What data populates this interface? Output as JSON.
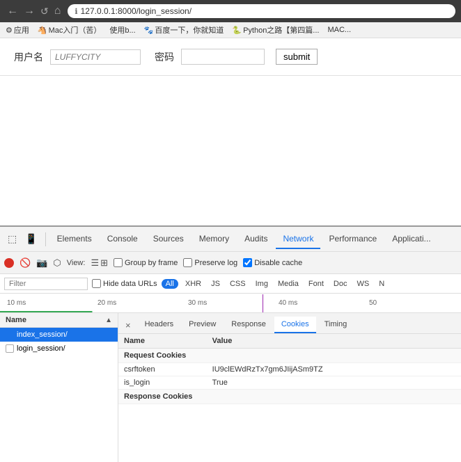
{
  "browser": {
    "back_label": "←",
    "forward_label": "→",
    "reload_label": "↺",
    "home_label": "⌂",
    "address": "127.0.0.1:8000/login_session/",
    "address_icon": "ℹ"
  },
  "bookmarks": {
    "items": [
      {
        "label": "应用",
        "icon": "⚙"
      },
      {
        "label": "Mac入门（苦）",
        "icon": "🐴"
      },
      {
        "label": "使用b...",
        "icon": ""
      },
      {
        "label": "百度一下，你就知道",
        "icon": "🐾"
      },
      {
        "label": "Python之路【第四篇...",
        "icon": "🐍"
      },
      {
        "label": "MAC...",
        "icon": ""
      }
    ]
  },
  "page": {
    "username_label": "用户名",
    "username_placeholder": "LUFFYCITY",
    "password_label": "密码",
    "password_value": "",
    "submit_label": "submit"
  },
  "devtools": {
    "tabs": [
      {
        "label": "Elements",
        "active": false
      },
      {
        "label": "Console",
        "active": false
      },
      {
        "label": "Sources",
        "active": false
      },
      {
        "label": "Memory",
        "active": false
      },
      {
        "label": "Audits",
        "active": false
      },
      {
        "label": "Network",
        "active": true
      },
      {
        "label": "Performance",
        "active": false
      },
      {
        "label": "Applicati...",
        "active": false
      }
    ],
    "network": {
      "view_label": "View:",
      "group_by_frame_label": "Group by frame",
      "preserve_log_label": "Preserve log",
      "disable_cache_label": "Disable cache",
      "disable_cache_checked": true,
      "preserve_log_checked": false,
      "filter_placeholder": "Filter",
      "hide_data_urls_label": "Hide data URLs",
      "filter_types": [
        "All",
        "XHR",
        "JS",
        "CSS",
        "Img",
        "Media",
        "Font",
        "Doc",
        "WS",
        "N..."
      ],
      "active_filter": "All",
      "timeline_labels": [
        "10 ms",
        "20 ms",
        "30 ms",
        "40 ms",
        "50"
      ],
      "name_column_label": "Name",
      "name_sort_icon": "▲",
      "close_detail_label": "×",
      "detail_tabs": [
        "Headers",
        "Preview",
        "Response",
        "Cookies",
        "Timing"
      ],
      "active_detail_tab": "Cookies",
      "cookies_columns": [
        {
          "label": "Name"
        },
        {
          "label": "Value"
        }
      ],
      "cookies_sections": [
        {
          "section_label": "Request Cookies",
          "rows": [
            {
              "name": "csrftoken",
              "value": "IU9clEWdRzTx7gm6JIijASm9TZ"
            },
            {
              "name": "is_login",
              "value": "True"
            }
          ]
        },
        {
          "section_label": "Response Cookies",
          "rows": []
        }
      ],
      "name_items": [
        {
          "label": "index_session/",
          "selected": true,
          "favicon_type": "blue"
        },
        {
          "label": "login_session/",
          "selected": false,
          "favicon_type": "white"
        }
      ]
    }
  }
}
